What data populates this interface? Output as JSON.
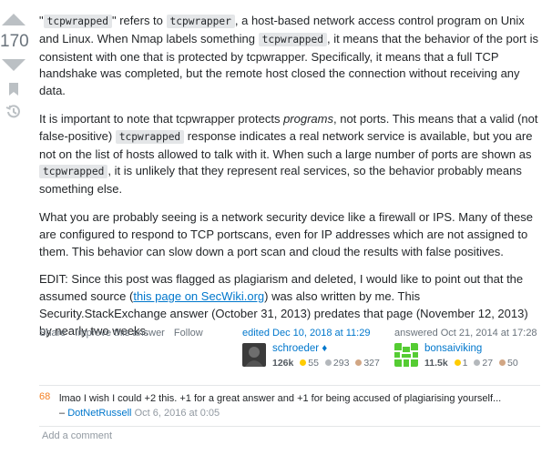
{
  "vote": {
    "count": "170"
  },
  "post": {
    "p1": {
      "q1": "\"",
      "code1": "tcpwrapped",
      "t1": "\" refers to ",
      "code2": "tcpwrapper",
      "t2": ", a host-based network access control program on Unix and Linux. When Nmap labels something ",
      "code3": "tcpwrapped",
      "t3": ", it means that the behavior of the port is consistent with one that is protected by tcpwrapper. Specifically, it means that a full TCP handshake was completed, but the remote host closed the connection without receiving any data."
    },
    "p2": {
      "t1": "It is important to note that tcpwrapper protects ",
      "em": "programs",
      "t2": ", not ports. This means that a valid (not false-positive) ",
      "code1": "tcpwrapped",
      "t3": " response indicates a real network service is available, but you are not on the list of hosts allowed to talk with it. When such a large number of ports are shown as ",
      "code2": "tcpwrapped",
      "t4": ", it is unlikely that they represent real services, so the behavior probably means something else."
    },
    "p3": "What you are probably seeing is a network security device like a firewall or IPS. Many of these are configured to respond to TCP portscans, even for IP addresses which are not assigned to them. This behavior can slow down a port scan and cloud the results with false positives.",
    "p4": {
      "t1": "EDIT: Since this post was flagged as plagiarism and deleted, I would like to point out that the assumed source (",
      "link": "this page on SecWiki.org",
      "t2": ") was also written by me. This Security.StackExchange answer (October 31, 2013) predates that page (November 12, 2013) by nearly two weeks."
    }
  },
  "actions": {
    "share": "Share",
    "improve": "Improve this answer",
    "follow": "Follow"
  },
  "editor": {
    "when": "edited Dec 10, 2018 at 11:29",
    "name": "schroeder",
    "diamond": "♦",
    "rep": "126k",
    "gold": "55",
    "silver": "293",
    "bronze": "327"
  },
  "author": {
    "when": "answered Oct 21, 2014 at 17:28",
    "name": "bonsaiviking",
    "rep": "11.5k",
    "gold": "1",
    "silver": "27",
    "bronze": "50"
  },
  "comment": {
    "score": "68",
    "text": "lmao I wish I could +2 this. +1 for a great answer and +1 for being accused of plagiarising yourself...",
    "dash": " – ",
    "user": "DotNetRussell",
    "date": "Oct 6, 2016 at 0:05"
  },
  "add_comment": "Add a comment",
  "colors": {
    "link": "#0077cc",
    "comment_score": "#f48024",
    "vote_arrow": "#bbc0c4"
  },
  "icons": [
    "vote-up-icon",
    "vote-down-icon",
    "bookmark-icon",
    "history-icon",
    "diamond-icon"
  ]
}
